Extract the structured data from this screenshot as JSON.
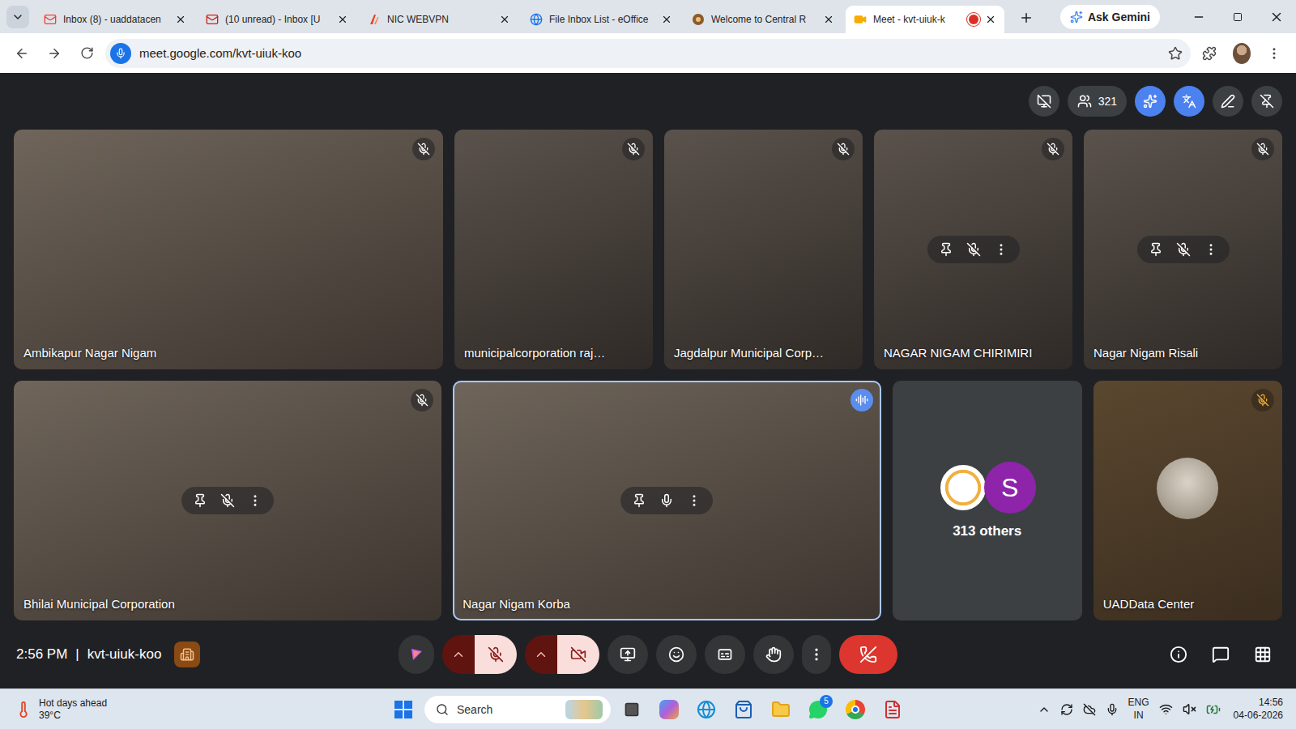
{
  "browser": {
    "tabs": [
      {
        "label": "Inbox (8) - uaddatacen",
        "kind": "gmail",
        "selected": false,
        "recording": false
      },
      {
        "label": "(10 unread) - Inbox [U",
        "kind": "mail",
        "selected": false,
        "recording": false
      },
      {
        "label": "NIC WEBVPN",
        "kind": "vpn",
        "selected": false,
        "recording": false
      },
      {
        "label": "File Inbox List - eOffice",
        "kind": "eoffice",
        "selected": false,
        "recording": false
      },
      {
        "label": "Welcome to Central R",
        "kind": "web",
        "selected": false,
        "recording": false
      },
      {
        "label": "Meet - kvt-uiuk-k",
        "kind": "meet",
        "selected": true,
        "recording": true
      }
    ],
    "gemini_button": "Ask Gemini",
    "url": "meet.google.com/kvt-uiuk-koo",
    "bookmarked": false
  },
  "meet": {
    "people_count": "321",
    "tools": [
      {
        "kind": "presentation",
        "active": false
      },
      {
        "kind": "gemini",
        "active": true
      },
      {
        "kind": "translate",
        "active": true
      },
      {
        "kind": "annotate",
        "active": false
      },
      {
        "kind": "unpin",
        "active": false
      }
    ],
    "tile_rows": [
      [
        {
          "kind": "room",
          "name": "Ambikapur Nagar Nigam",
          "muted": true,
          "speaking": false,
          "controls_shown": false
        },
        {
          "kind": "person",
          "name": "municipalcorporation raj…",
          "muted": true,
          "speaking": false,
          "controls_shown": false
        },
        {
          "kind": "person",
          "name": "Jagdalpur Municipal Corp…",
          "muted": true,
          "speaking": false,
          "controls_shown": false
        },
        {
          "kind": "person",
          "name": "NAGAR NIGAM CHIRIMIRI",
          "muted": true,
          "speaking": false,
          "controls_shown": true
        },
        {
          "kind": "person",
          "name": "Nagar Nigam Risali",
          "muted": true,
          "speaking": false,
          "controls_shown": true
        }
      ],
      [
        {
          "kind": "room",
          "name": "Bhilai Municipal Corporation",
          "muted": true,
          "speaking": false,
          "controls_shown": true
        },
        {
          "kind": "room",
          "name": "Nagar Nigam Korba",
          "muted": false,
          "speaking": true,
          "controls_shown": true
        },
        {
          "kind": "others",
          "label": "313 others",
          "avatar_letter": "S",
          "muted": false,
          "speaking": false,
          "controls_shown": false
        },
        {
          "kind": "avatar",
          "name": "UADData Center",
          "muted": true,
          "speaking": false,
          "controls_shown": false
        }
      ]
    ],
    "time": "2:56 PM",
    "separator": "|",
    "meeting_code": "kvt-uiuk-koo",
    "controls": {
      "mic_on": false,
      "camera_on": false,
      "hand_raised": false,
      "captions_on": false
    }
  },
  "taskbar": {
    "weather_title": "Hot days ahead",
    "weather_temp": "39°C",
    "search_placeholder": "Search",
    "whatsapp_badge": "5",
    "language": "ENG",
    "region": "IN",
    "time": "14:56",
    "date": "04-06-2026",
    "volume_muted": true
  }
}
